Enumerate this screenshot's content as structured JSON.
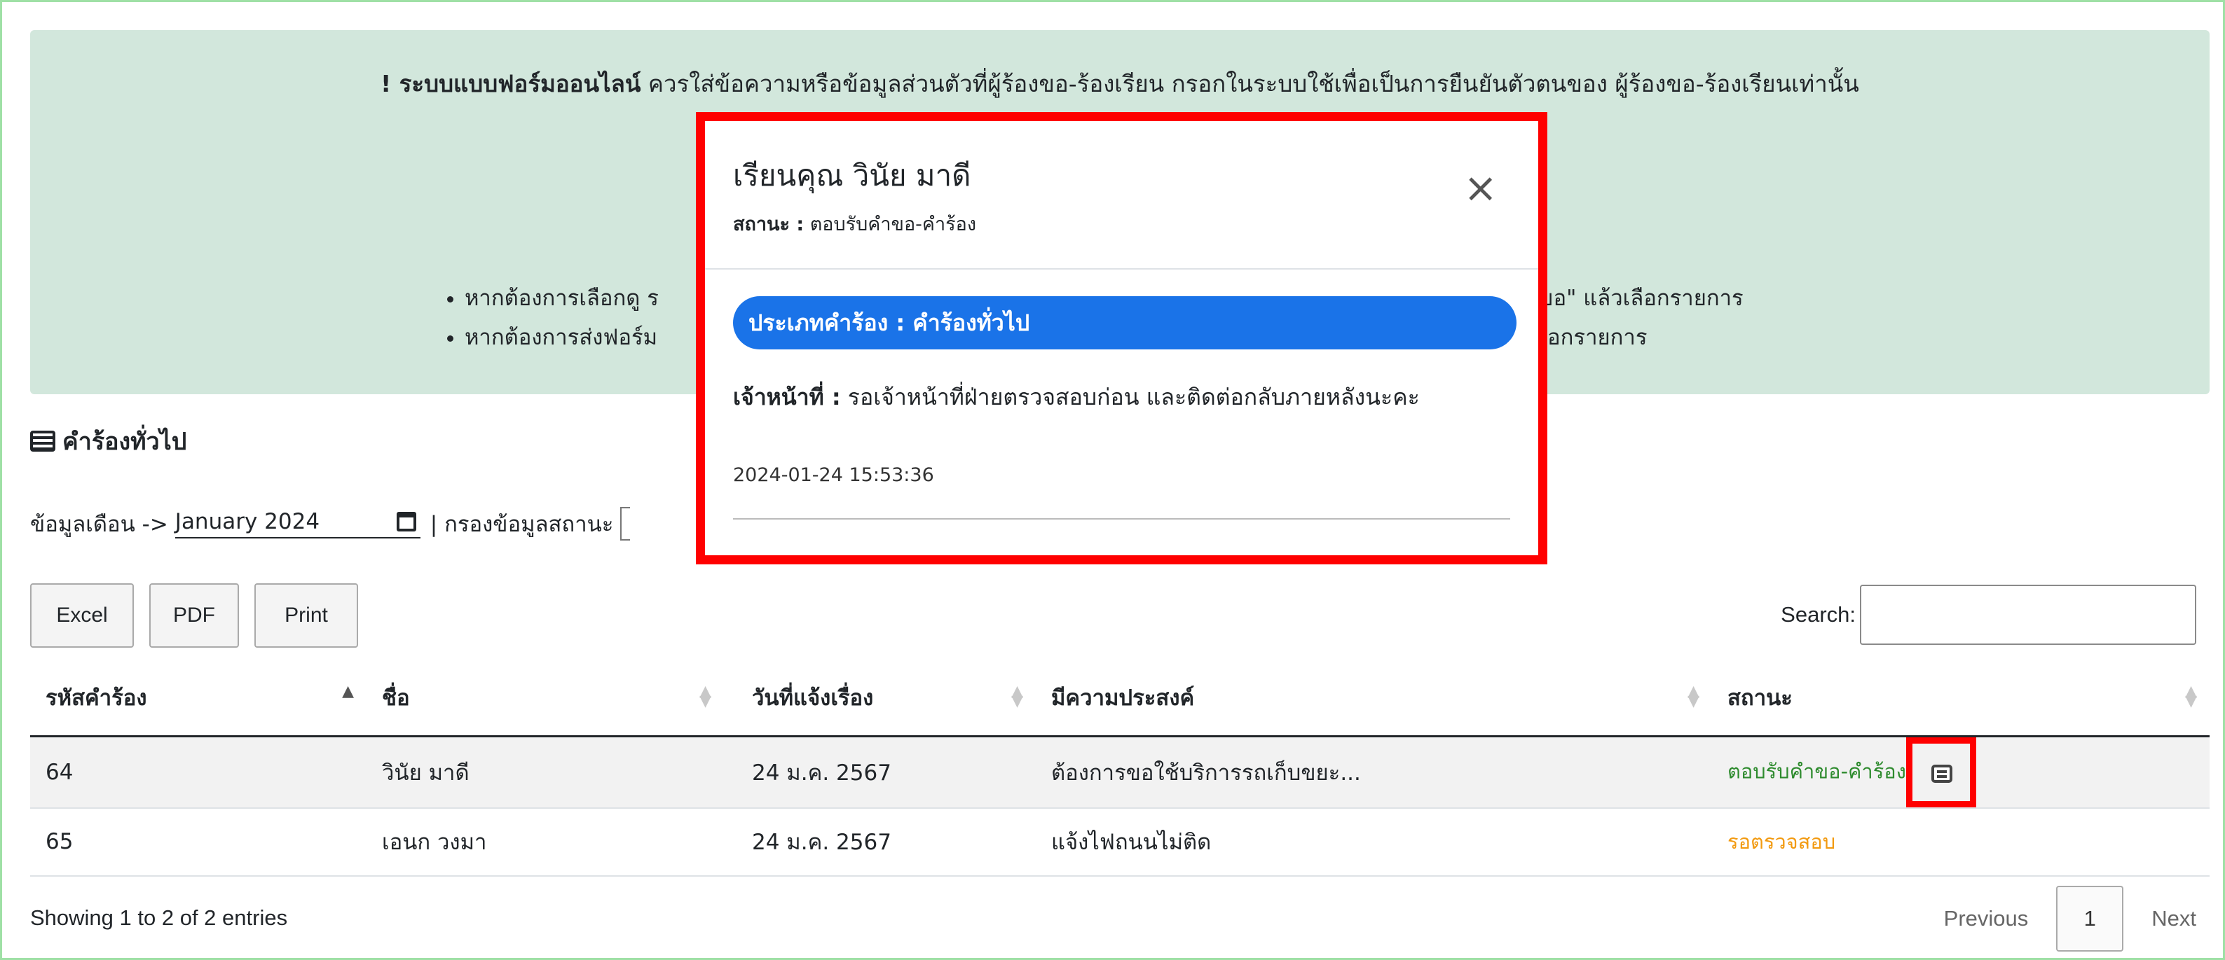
{
  "alert": {
    "bold_prefix": "! ระบบแบบฟอร์มออนไลน์",
    "line1_rest": " ควรใส่ข้อความหรือข้อมูลส่วนตัวที่ผู้ร้องขอ-ร้องเรียน กรอกในระบบใช้เพื่อเป็นการยืนยันตัวตนของ ผู้ร้องขอ-ร้องเรียนเท่านั้น",
    "bullet1": "หากต้องการเลือกดู ร",
    "bullet1_tail": "ร้องขอ\" แล้วเลือกรายการ",
    "bullet2": "หากต้องการส่งฟอร์ม",
    "bullet2_tail": "อกรายการ"
  },
  "section": {
    "title": "คำร้องทั่วไป"
  },
  "filter": {
    "month_label": "ข้อมูลเดือน ->",
    "month_value": "January 2024",
    "status_label": "| กรองข้อมูลสถานะ"
  },
  "buttons": {
    "excel": "Excel",
    "pdf": "PDF",
    "print": "Print"
  },
  "search": {
    "label": "Search:"
  },
  "table": {
    "headers": [
      "รหัสคำร้อง",
      "ชื่อ",
      "วันที่แจ้งเรื่อง",
      "มีความประสงค์",
      "สถานะ"
    ],
    "rows": [
      {
        "id": "64",
        "name": "วินัย มาดี",
        "date": "24 ม.ค. 2567",
        "purpose": "ต้องการขอใช้บริการรถเก็บขยะ...",
        "status": "ตอบรับคำขอ-คำร้อง"
      },
      {
        "id": "65",
        "name": "เอนก วงมา",
        "date": "24 ม.ค. 2567",
        "purpose": "แจ้งไฟถนนไม่ติด",
        "status": "รอตรวจสอบ"
      }
    ]
  },
  "info": {
    "text": "Showing 1 to 2 of 2 entries"
  },
  "pager": {
    "previous": "Previous",
    "page": "1",
    "next": "Next"
  },
  "modal": {
    "title": "เรียนคุณ วินัย มาดี",
    "status_label": "สถานะ :",
    "status_value": " ตอบรับคำขอ-คำร้อง",
    "close": "×",
    "type_label": "ประเภทคำร้อง : คำร้องทั่วไป",
    "officer_label": "เจ้าหน้าที่ :",
    "officer_text": " รอเจ้าหน้าที่ฝ่ายตรวจสอบก่อน และติดต่อกลับภายหลังนะคะ",
    "timestamp": "2024-01-24 15:53:36"
  },
  "colors": {
    "accent": "#1a73e8",
    "highlight": "#ff0000",
    "ok": "#2e8b2e",
    "wait": "#f29a10"
  }
}
